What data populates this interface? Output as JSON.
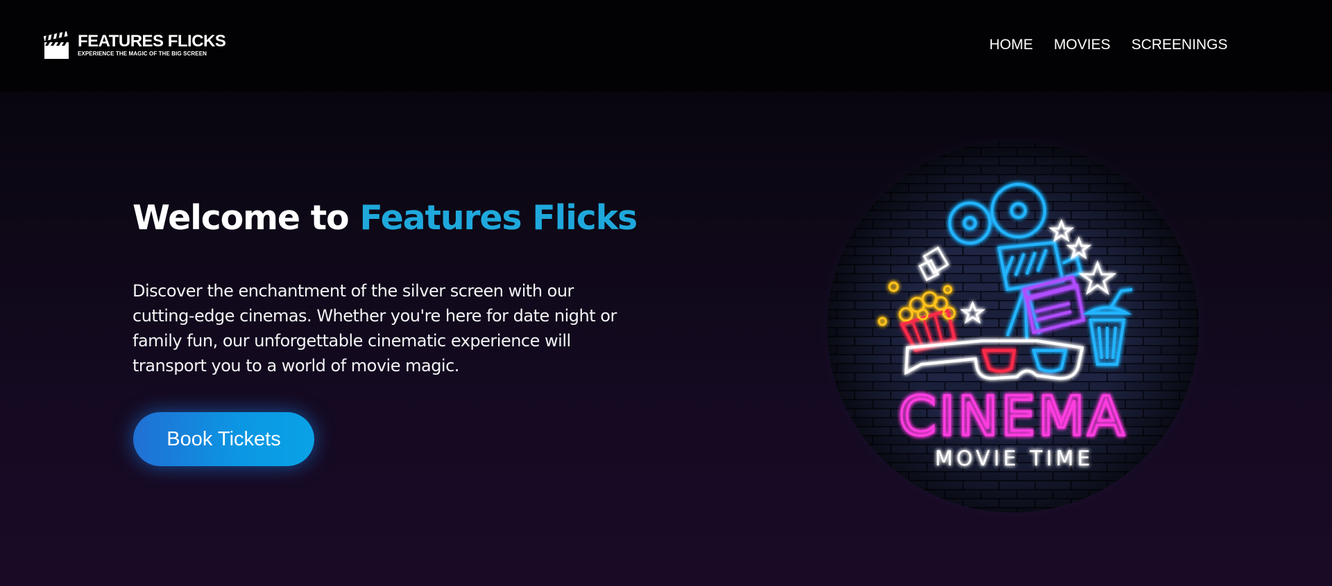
{
  "header": {
    "brand_name": "FEATURES FLICKS",
    "brand_tagline": "EXPERIENCE THE MAGIC OF THE BIG SCREEN",
    "logo_icon": "clapperboard-icon",
    "nav": [
      {
        "label": "HOME"
      },
      {
        "label": "MOVIES"
      },
      {
        "label": "SCREENINGS"
      }
    ]
  },
  "hero": {
    "title_prefix": "Welcome to ",
    "title_accent": "Features Flicks",
    "description": "Discover the enchantment of the silver screen with our cutting-edge cinemas. Whether you're here for date night or family fun, our unforgettable cinematic experience will transport you to a world of movie magic.",
    "cta_label": "Book Tickets"
  },
  "neon_sign": {
    "title": "CINEMA",
    "subtitle": "MOVIE TIME"
  },
  "colors": {
    "accent": "#1fa8dc",
    "button_start": "#2170d4",
    "button_end": "#0aa2e6",
    "neon_pink": "#ff3de0",
    "neon_blue": "#24b4ff",
    "neon_yellow": "#ffc21a",
    "neon_red": "#ff2a4a",
    "neon_purple": "#b04dff"
  }
}
